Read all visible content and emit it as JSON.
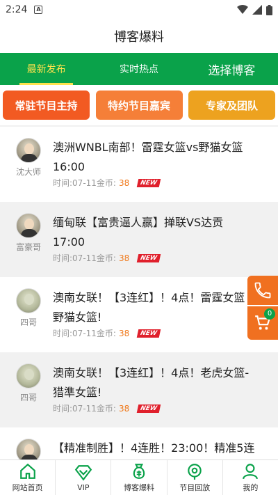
{
  "status": {
    "time": "2:24",
    "notif_icon": "A"
  },
  "header": {
    "title": "博客爆料"
  },
  "tabs": [
    {
      "label": "最新发布"
    },
    {
      "label": "实时热点"
    },
    {
      "label": "选择博客"
    }
  ],
  "categories": [
    {
      "label": "常驻节目主持",
      "color": "#f25a22"
    },
    {
      "label": "特约节目嘉宾",
      "color": "#f57f38"
    },
    {
      "label": "专家及团队",
      "color": "#eda21f"
    }
  ],
  "posts": [
    {
      "author": "沈大师",
      "title_l1": "澳洲WNBL南部！雷霆女篮vs野猫女篮",
      "title_l2": "16:00",
      "meta_prefix": "时间:",
      "date": "07-11",
      "coin_label": "金币:",
      "coin": "38",
      "badge": "NEW"
    },
    {
      "author": "富豪哥",
      "title_l1": "缅甸联【富贵逼人赢】掸联VS达贡",
      "title_l2": "17:00",
      "meta_prefix": "时间:",
      "date": "07-11",
      "coin_label": "金币:",
      "coin": "38",
      "badge": "NEW"
    },
    {
      "author": "四哥",
      "title_l1": "澳南女联！【3连红】！4点！雷霆女篮",
      "title_l2": "野猫女篮!",
      "meta_prefix": "时间:",
      "date": "07-11",
      "coin_label": "金币:",
      "coin": "38",
      "badge": "NEW"
    },
    {
      "author": "四哥",
      "title_l1": "澳南女联！【3连红】！4点！老虎女篮-",
      "title_l2": "猎準女篮!",
      "meta_prefix": "时间:",
      "date": "07-11",
      "coin_label": "金币:",
      "coin": "38",
      "badge": "NEW"
    },
    {
      "author": "",
      "title_l1": "【精准制胜】！4连胜！23:00！精准5连",
      "title_l2": "",
      "meta_prefix": "",
      "date": "",
      "coin_label": "",
      "coin": "",
      "badge": ""
    }
  ],
  "float": {
    "cart_count": "0"
  },
  "bottom_nav": [
    {
      "label": "网站首页",
      "icon": "home-icon"
    },
    {
      "label": "VIP",
      "icon": "vip-icon"
    },
    {
      "label": "博客爆料",
      "icon": "money-bag-icon"
    },
    {
      "label": "节目回放",
      "icon": "playback-icon"
    },
    {
      "label": "我的",
      "icon": "user-icon"
    }
  ],
  "colors": {
    "primary_green": "#0aa24a",
    "active_tab": "#ffe34d",
    "accent_orange": "#f07020",
    "coin_orange": "#f0791b",
    "badge_red": "#e0202c"
  }
}
